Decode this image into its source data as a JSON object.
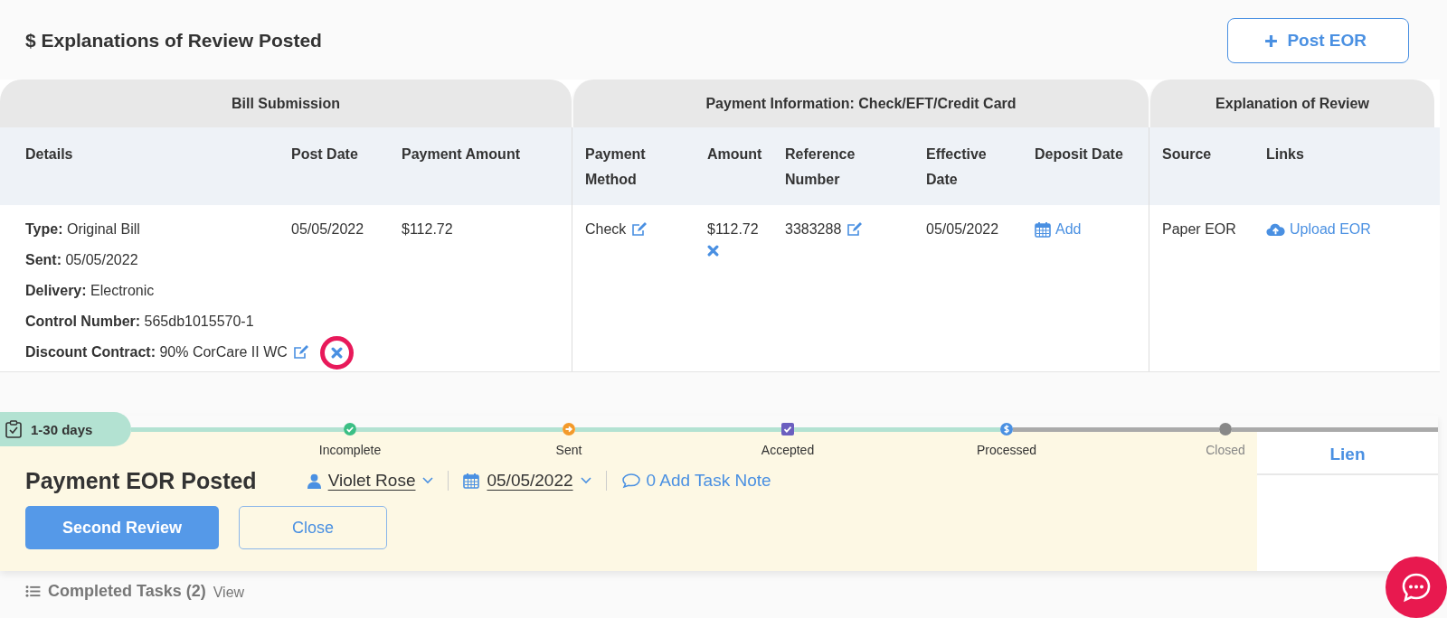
{
  "header": {
    "title": "$ Explanations of Review Posted",
    "action": "Post EOR"
  },
  "table": {
    "groups": [
      {
        "title": "Bill Submission",
        "columns": [
          "Details",
          "Post Date",
          "Payment Amount"
        ]
      },
      {
        "title": "Payment Information: Check/EFT/Credit Card",
        "columns": [
          "Payment Method",
          "Amount",
          "Reference Number",
          "Effective Date",
          "Deposit Date"
        ]
      },
      {
        "title": "Explanation of Review",
        "columns": [
          "Source",
          "Links"
        ]
      }
    ],
    "row": [
      {
        "kind": "details",
        "lines": [
          {
            "label": "Type:",
            "value": "Original Bill"
          },
          {
            "label": "Sent:",
            "value": "05/05/2022"
          },
          {
            "label": "Delivery:",
            "value": "Electronic"
          },
          {
            "label": "Control Number:",
            "value": "565db1015570-1"
          },
          {
            "label": "Discount Contract:",
            "value": "90% CorCare II WC",
            "editable": true,
            "removable": true,
            "remove_highlighted": true
          }
        ]
      },
      {
        "kind": "text",
        "text": "05/05/2022"
      },
      {
        "kind": "text",
        "text": "$112.72"
      },
      {
        "kind": "text",
        "text": "Check",
        "editable": true
      },
      {
        "kind": "stacked",
        "text": "$112.72",
        "removable": true,
        "remove_highlighted": false
      },
      {
        "kind": "text",
        "text": "3383288",
        "editable": true
      },
      {
        "kind": "text",
        "text": "05/05/2022"
      },
      {
        "kind": "add",
        "text": "Add"
      },
      {
        "kind": "text",
        "text": "Paper EOR"
      },
      {
        "kind": "upload",
        "text": "Upload EOR"
      }
    ]
  },
  "timeline": {
    "badge": "1-30 days",
    "stages": [
      {
        "label": "Incomplete",
        "reached": true
      },
      {
        "label": "Sent",
        "reached": true
      },
      {
        "label": "Accepted",
        "reached": true
      },
      {
        "label": "Processed",
        "reached": true
      },
      {
        "label": "Closed",
        "reached": false
      }
    ]
  },
  "task": {
    "title": "Payment EOR Posted",
    "assignee": "Violet Rose",
    "date": "05/05/2022",
    "note": "0 Add Task Note",
    "buttons": [
      {
        "label": "Second Review",
        "kind": "primary"
      },
      {
        "label": "Close",
        "kind": "secondary"
      }
    ]
  },
  "side_tab": {
    "label": "Lien"
  },
  "completed": {
    "label": "Completed Tasks (2)",
    "link": "View"
  }
}
